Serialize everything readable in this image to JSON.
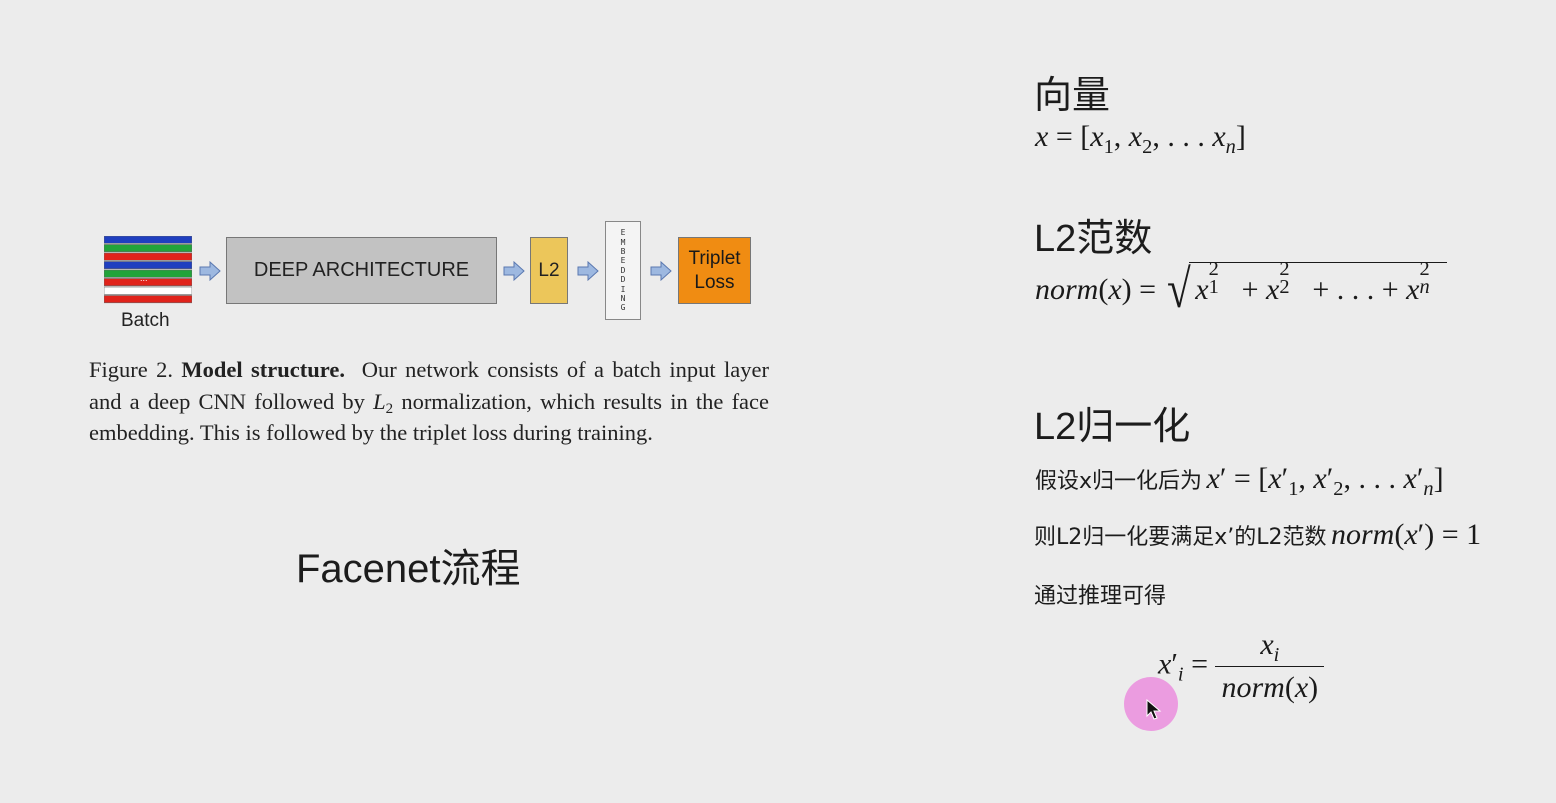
{
  "diagram": {
    "batch_dots": "...",
    "batch_label": "Batch",
    "deep_label": "DEEP ARCHITECTURE",
    "l2_label": "L2",
    "embedding_label": "EMBEDDING",
    "triplet_line1": "Triplet",
    "triplet_line2": "Loss",
    "stripe_colors": [
      "#1f3fbf",
      "#22a33a",
      "#e0231b",
      "#1f3fbf",
      "#22a33a",
      "#e0231b",
      "#ffffff",
      "#e0231b"
    ],
    "arrow_color": "#9db8e0"
  },
  "caption": {
    "figure_label": "Figure 2.",
    "bold_title": "Model structure.",
    "text_before_l2": "Our network consists of a batch input layer and a deep CNN followed by",
    "l2_symbol": "L",
    "l2_subscript": "2",
    "text_after_l2": "normalization, which results in the face embedding. This is followed by the triplet loss during training."
  },
  "facenet_title": "Facenet流程",
  "notes": {
    "vector_heading": "向量",
    "norm_heading": "L2范数",
    "l2norm_heading": "L2归一化",
    "assume_text": "假设x归一化后为",
    "then_text": "则L2归一化要满足x’的L2范数",
    "derive_text": "通过推理可得"
  }
}
